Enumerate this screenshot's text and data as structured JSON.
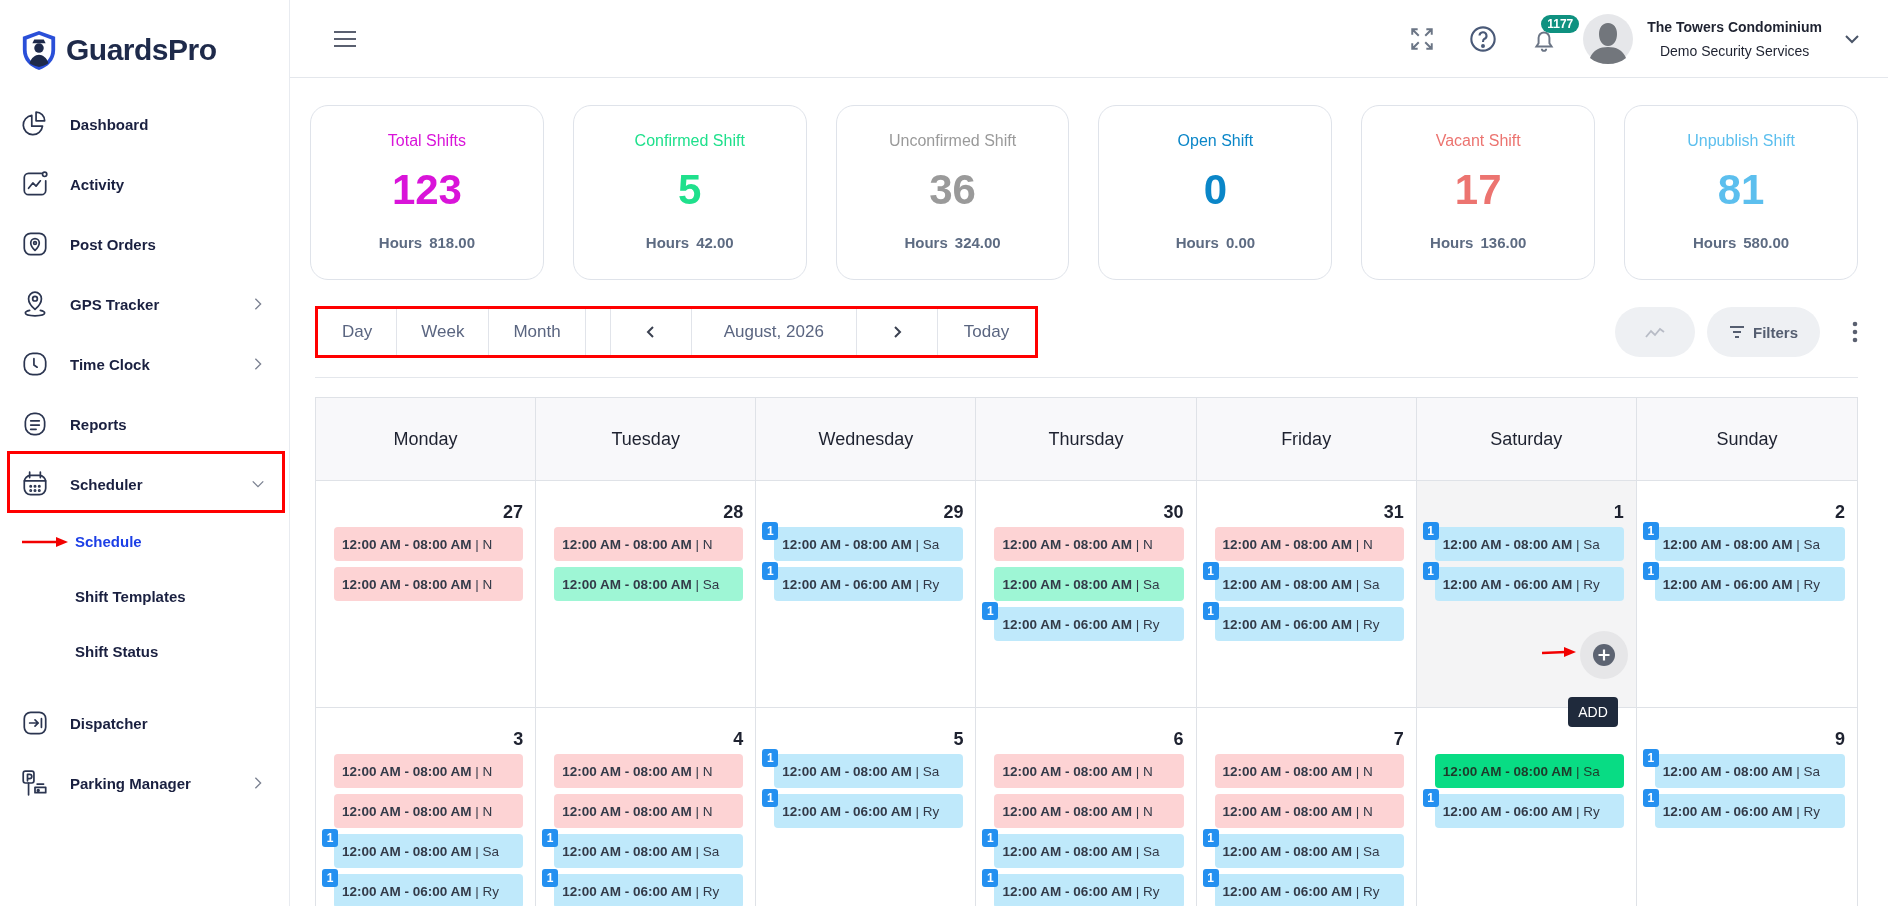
{
  "brand": {
    "name": "GuardsPro"
  },
  "sidebar": {
    "items": [
      {
        "label": "Dashboard",
        "kind": "link",
        "marked": false,
        "selected": false
      },
      {
        "label": "Activity",
        "kind": "link",
        "marked": false,
        "selected": false
      },
      {
        "label": "Post Orders",
        "kind": "link",
        "marked": false,
        "selected": false
      },
      {
        "label": "GPS Tracker",
        "kind": "group",
        "expanded": false,
        "marked": false,
        "selected": false
      },
      {
        "label": "Time Clock",
        "kind": "group",
        "expanded": false,
        "marked": false,
        "selected": false
      },
      {
        "label": "Reports",
        "kind": "link",
        "marked": false,
        "selected": false
      },
      {
        "label": "Scheduler",
        "kind": "group",
        "expanded": true,
        "marked": true,
        "selected": false,
        "children": [
          {
            "label": "Schedule",
            "selected": true,
            "marked": true
          },
          {
            "label": "Shift Templates",
            "selected": false,
            "marked": false
          },
          {
            "label": "Shift Status",
            "selected": false,
            "marked": false
          }
        ]
      },
      {
        "label": "Dispatcher",
        "kind": "link",
        "marked": false,
        "selected": false
      },
      {
        "label": "Parking Manager",
        "kind": "group",
        "expanded": false,
        "marked": false,
        "selected": false
      }
    ]
  },
  "header": {
    "notification_count": "1177",
    "user": {
      "name": "The Towers Condominium",
      "company": "Demo Security Services"
    }
  },
  "stats": [
    {
      "label": "Total Shifts",
      "value": "123",
      "hours_label": "Hours",
      "hours": "818.00",
      "color": "#d914d9"
    },
    {
      "label": "Confirmed Shift",
      "value": "5",
      "hours_label": "Hours",
      "hours": "42.00",
      "color": "#1fe08c"
    },
    {
      "label": "Unconfirmed Shift",
      "value": "36",
      "hours_label": "Hours",
      "hours": "324.00",
      "color": "#9a9a9a"
    },
    {
      "label": "Open Shift",
      "value": "0",
      "hours_label": "Hours",
      "hours": "0.00",
      "color": "#0a86c8"
    },
    {
      "label": "Vacant Shift",
      "value": "17",
      "hours_label": "Hours",
      "hours": "136.00",
      "color": "#ec7470"
    },
    {
      "label": "Unpublish Shift",
      "value": "81",
      "hours_label": "Hours",
      "hours": "580.00",
      "color": "#5cbfee"
    }
  ],
  "toolbar": {
    "marked": true,
    "views": [
      "Day",
      "Week",
      "Month"
    ],
    "period": "August, 2026",
    "today": "Today",
    "chart_button": {
      "disabled": true
    },
    "filters": "Filters"
  },
  "calendar": {
    "weekdays": [
      "Monday",
      "Tuesday",
      "Wednesday",
      "Thursday",
      "Friday",
      "Saturday",
      "Sunday"
    ],
    "weeks": [
      {
        "days": [
          {
            "date": "27",
            "hovered": false,
            "events": [
              {
                "text": "**12:00 AM - 08:00 AM** | N",
                "color": "#fdd3d4"
              },
              {
                "text": "**12:00 AM - 08:00 AM** | N",
                "color": "#fdd3d4"
              }
            ]
          },
          {
            "date": "28",
            "hovered": false,
            "events": [
              {
                "text": "**12:00 AM - 08:00 AM** | N",
                "color": "#fdd3d4"
              },
              {
                "text": "**12:00 AM - 08:00 AM** | Sa",
                "color": "#9ef6d5"
              }
            ]
          },
          {
            "date": "29",
            "hovered": false,
            "events": [
              {
                "text": "**12:00 AM - 08:00 AM** | Sa",
                "color": "#bfe9fb",
                "badge": "1"
              },
              {
                "text": "**12:00 AM - 06:00 AM** | Ry",
                "color": "#bfe9fb",
                "badge": "1"
              }
            ]
          },
          {
            "date": "30",
            "hovered": false,
            "events": [
              {
                "text": "**12:00 AM - 08:00 AM** | N",
                "color": "#fdd3d4"
              },
              {
                "text": "**12:00 AM - 08:00 AM** | Sa",
                "color": "#9ef6d5"
              },
              {
                "text": "**12:00 AM - 06:00 AM** | Ry",
                "color": "#bfe9fb",
                "badge": "1"
              }
            ]
          },
          {
            "date": "31",
            "hovered": false,
            "events": [
              {
                "text": "**12:00 AM - 08:00 AM** | N",
                "color": "#fdd3d4"
              },
              {
                "text": "**12:00 AM - 08:00 AM** | Sa",
                "color": "#bfe9fb",
                "badge": "1"
              },
              {
                "text": "**12:00 AM - 06:00 AM** | Ry",
                "color": "#bfe9fb",
                "badge": "1"
              }
            ]
          },
          {
            "date": "1",
            "hovered": true,
            "add_tooltip": "ADD",
            "events": [
              {
                "text": "**12:00 AM - 08:00 AM** | Sa",
                "color": "#bfe9fb",
                "badge": "1"
              },
              {
                "text": "**12:00 AM - 06:00 AM** | Ry",
                "color": "#bfe9fb",
                "badge": "1"
              }
            ]
          },
          {
            "date": "2",
            "hovered": false,
            "events": [
              {
                "text": "**12:00 AM - 08:00 AM** | Sa",
                "color": "#bfe9fb",
                "badge": "1"
              },
              {
                "text": "**12:00 AM - 06:00 AM** | Ry",
                "color": "#bfe9fb",
                "badge": "1"
              }
            ]
          }
        ]
      },
      {
        "days": [
          {
            "date": "3",
            "hovered": false,
            "events": [
              {
                "text": "**12:00 AM - 08:00 AM** | N",
                "color": "#fdd3d4"
              },
              {
                "text": "**12:00 AM - 08:00 AM** | N",
                "color": "#fdd3d4"
              },
              {
                "text": "**12:00 AM - 08:00 AM** | Sa",
                "color": "#bfe9fb",
                "badge": "1"
              },
              {
                "text": "**12:00 AM - 06:00 AM** | Ry",
                "color": "#bfe9fb",
                "badge": "1"
              }
            ]
          },
          {
            "date": "4",
            "hovered": false,
            "events": [
              {
                "text": "**12:00 AM - 08:00 AM** | N",
                "color": "#fdd3d4"
              },
              {
                "text": "**12:00 AM - 08:00 AM** | N",
                "color": "#fdd3d4"
              },
              {
                "text": "**12:00 AM - 08:00 AM** | Sa",
                "color": "#bfe9fb",
                "badge": "1"
              },
              {
                "text": "**12:00 AM - 06:00 AM** | Ry",
                "color": "#bfe9fb",
                "badge": "1"
              }
            ]
          },
          {
            "date": "5",
            "hovered": false,
            "events": [
              {
                "text": "**12:00 AM - 08:00 AM** | Sa",
                "color": "#bfe9fb",
                "badge": "1"
              },
              {
                "text": "**12:00 AM - 06:00 AM** | Ry",
                "color": "#bfe9fb",
                "badge": "1"
              }
            ]
          },
          {
            "date": "6",
            "hovered": false,
            "events": [
              {
                "text": "**12:00 AM - 08:00 AM** | N",
                "color": "#fdd3d4"
              },
              {
                "text": "**12:00 AM - 08:00 AM** | N",
                "color": "#fdd3d4"
              },
              {
                "text": "**12:00 AM - 08:00 AM** | Sa",
                "color": "#bfe9fb",
                "badge": "1"
              },
              {
                "text": "**12:00 AM - 06:00 AM** | Ry",
                "color": "#bfe9fb",
                "badge": "1"
              }
            ]
          },
          {
            "date": "7",
            "hovered": false,
            "events": [
              {
                "text": "**12:00 AM - 08:00 AM** | N",
                "color": "#fdd3d4"
              },
              {
                "text": "**12:00 AM - 08:00 AM** | N",
                "color": "#fdd3d4"
              },
              {
                "text": "**12:00 AM - 08:00 AM** | Sa",
                "color": "#bfe9fb",
                "badge": "1"
              },
              {
                "text": "**12:00 AM - 06:00 AM** | Ry",
                "color": "#bfe9fb",
                "badge": "1"
              }
            ]
          },
          {
            "hovered": false,
            "events": [
              {
                "text": "**12:00 AM - 08:00 AM** | Sa",
                "color": "#08dc84"
              },
              {
                "text": "**12:00 AM - 06:00 AM** | Ry",
                "color": "#bfe9fb",
                "badge": "1"
              }
            ]
          },
          {
            "date": "9",
            "hovered": false,
            "events": [
              {
                "text": "**12:00 AM - 08:00 AM** | Sa",
                "color": "#bfe9fb",
                "badge": "1"
              },
              {
                "text": "**12:00 AM - 06:00 AM** | Ry",
                "color": "#bfe9fb",
                "badge": "1"
              }
            ]
          }
        ]
      }
    ]
  }
}
